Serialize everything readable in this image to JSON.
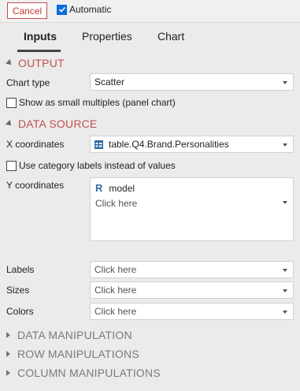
{
  "topbar": {
    "cancel_label": "Cancel",
    "automatic_label": "Automatic",
    "automatic_checked": true
  },
  "tabs": [
    {
      "label": "Inputs",
      "active": true
    },
    {
      "label": "Properties",
      "active": false
    },
    {
      "label": "Chart",
      "active": false
    }
  ],
  "output": {
    "title": "OUTPUT",
    "chart_type_label": "Chart type",
    "chart_type_value": "Scatter",
    "small_multiples_label": "Show as small multiples (panel chart)",
    "small_multiples_checked": false
  },
  "data_source": {
    "title": "DATA SOURCE",
    "x_label": "X coordinates",
    "x_value": "table.Q4.Brand.Personalities",
    "category_labels_label": "Use category labels instead of values",
    "category_labels_checked": false,
    "y_label": "Y coordinates",
    "y_item": "model",
    "y_placeholder": "Click here",
    "labels_label": "Labels",
    "labels_placeholder": "Click here",
    "sizes_label": "Sizes",
    "sizes_placeholder": "Click here",
    "colors_label": "Colors",
    "colors_placeholder": "Click here"
  },
  "collapsed_sections": [
    "DATA MANIPULATION",
    "ROW MANIPULATIONS",
    "COLUMN MANIPULATIONS"
  ],
  "colors": {
    "accent": "#c0504d",
    "checkbox_blue": "#0b6cd8",
    "r_icon_blue": "#2e6da4"
  }
}
